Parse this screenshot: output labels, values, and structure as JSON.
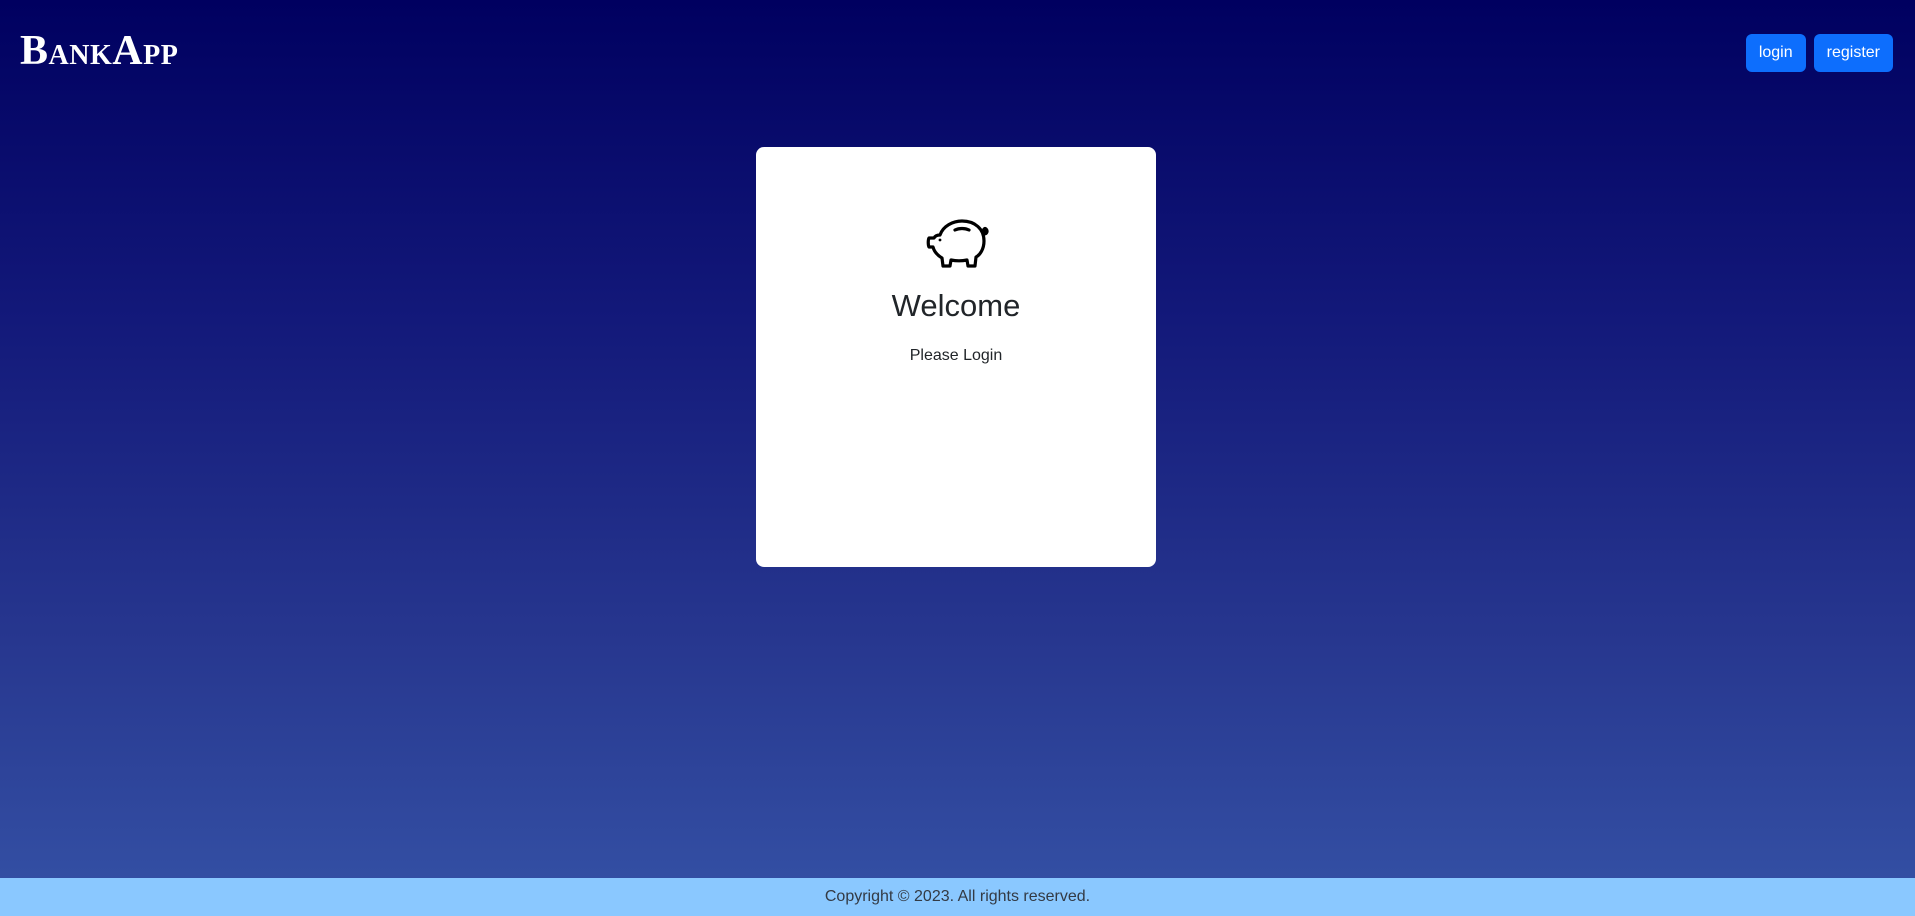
{
  "header": {
    "brand_first": "B",
    "brand_rest": "ANK",
    "brand_first2": "A",
    "brand_rest2": "PP",
    "login_label": "login",
    "register_label": "register"
  },
  "card": {
    "icon": "piggy-bank-icon",
    "title": "Welcome",
    "subtitle": "Please Login"
  },
  "footer": {
    "copyright": "Copyright © 2023. All rights reserved."
  },
  "colors": {
    "background_top": "#000060",
    "background_bottom": "#3552a6",
    "button": "#0d6efd",
    "footer": "#8ac8ff",
    "card": "#ffffff"
  }
}
